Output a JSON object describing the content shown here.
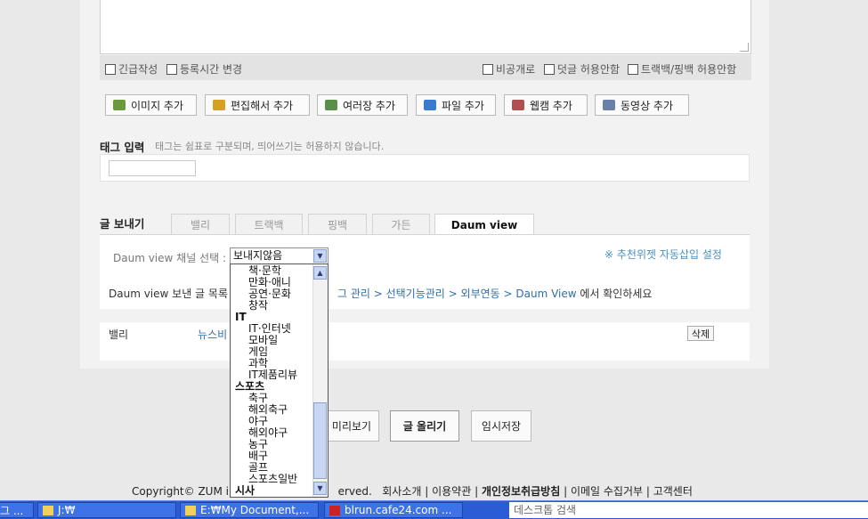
{
  "options": {
    "urgent": "긴급작성",
    "change_time": "등록시간 변경",
    "private": "비공개로",
    "no_comment": "덧글 허용안함",
    "no_trackback": "트랙백/핑백 허용안함"
  },
  "attach": [
    {
      "label": "이미지 추가",
      "icon": "image-icon",
      "color": "#6a9a3b"
    },
    {
      "label": "편집해서 추가",
      "icon": "edit-image-icon",
      "color": "#d8a020"
    },
    {
      "label": "여러장 추가",
      "icon": "multi-image-icon",
      "color": "#5a8f4a"
    },
    {
      "label": "파일 추가",
      "icon": "file-icon",
      "color": "#3a7bd0"
    },
    {
      "label": "웹캠 추가",
      "icon": "webcam-icon",
      "color": "#b05050"
    },
    {
      "label": "동영상 추가",
      "icon": "video-icon",
      "color": "#6b7fa8"
    }
  ],
  "tag": {
    "title": "태그 입력",
    "help": "태그는 쉼표로 구분되며, 띄어쓰기는 허용하지 않습니다.",
    "value": ""
  },
  "send": {
    "title": "글 보내기",
    "tabs": [
      "밸리",
      "트랙백",
      "핑백",
      "가든",
      "Daum view"
    ],
    "active_tab": "Daum view",
    "channel_label": "Daum view 채널 선택 :",
    "channel_selected": "보내지않음",
    "recommend_link": "※ 추천위젯 자동삽입 설정",
    "info_prefix": "Daum view 보낸 글 목록",
    "info_path": "그 관리 > 선택기능관리 > 외부연동 > Daum View",
    "info_suffix": " 에서 확인하세요"
  },
  "valley_row": {
    "label": "밸리",
    "link": "뉴스비",
    "delete": "삭제"
  },
  "actions": {
    "preview": "미리보기",
    "publish": "글 올리기",
    "draft": "임시저장"
  },
  "dropdown_options": [
    {
      "text": "책·문학",
      "group": false
    },
    {
      "text": "만화·애니",
      "group": false
    },
    {
      "text": "공연·문화",
      "group": false
    },
    {
      "text": "창작",
      "group": false
    },
    {
      "text": "IT",
      "group": true
    },
    {
      "text": "IT·인터넷",
      "group": false
    },
    {
      "text": "모바일",
      "group": false
    },
    {
      "text": "게임",
      "group": false
    },
    {
      "text": "과학",
      "group": false
    },
    {
      "text": "IT제품리뷰",
      "group": false
    },
    {
      "text": "스포츠",
      "group": true
    },
    {
      "text": "축구",
      "group": false
    },
    {
      "text": "해외축구",
      "group": false
    },
    {
      "text": "야구",
      "group": false
    },
    {
      "text": "해외야구",
      "group": false
    },
    {
      "text": "농구",
      "group": false
    },
    {
      "text": "배구",
      "group": false
    },
    {
      "text": "골프",
      "group": false
    },
    {
      "text": "스포츠일반",
      "group": false
    },
    {
      "text": "시사",
      "group": true
    }
  ],
  "footer": {
    "copyright_left": "Copyright© ZUM in",
    "copyright_right": "erved.",
    "links": [
      "회사소개",
      "이용약관",
      "개인정보취급방침",
      "이메일 수집거부",
      "고객센터"
    ]
  },
  "taskbar": {
    "items": [
      {
        "label": "그 ...",
        "icon": "window-icon"
      },
      {
        "label": "J:₩",
        "icon": "folder-icon"
      },
      {
        "label": "E:₩My Document,...",
        "icon": "folder-icon"
      },
      {
        "label": "blrun.cafe24.com ...",
        "icon": "filezilla-icon"
      }
    ],
    "desktop_search": "데스크톱 검색"
  }
}
